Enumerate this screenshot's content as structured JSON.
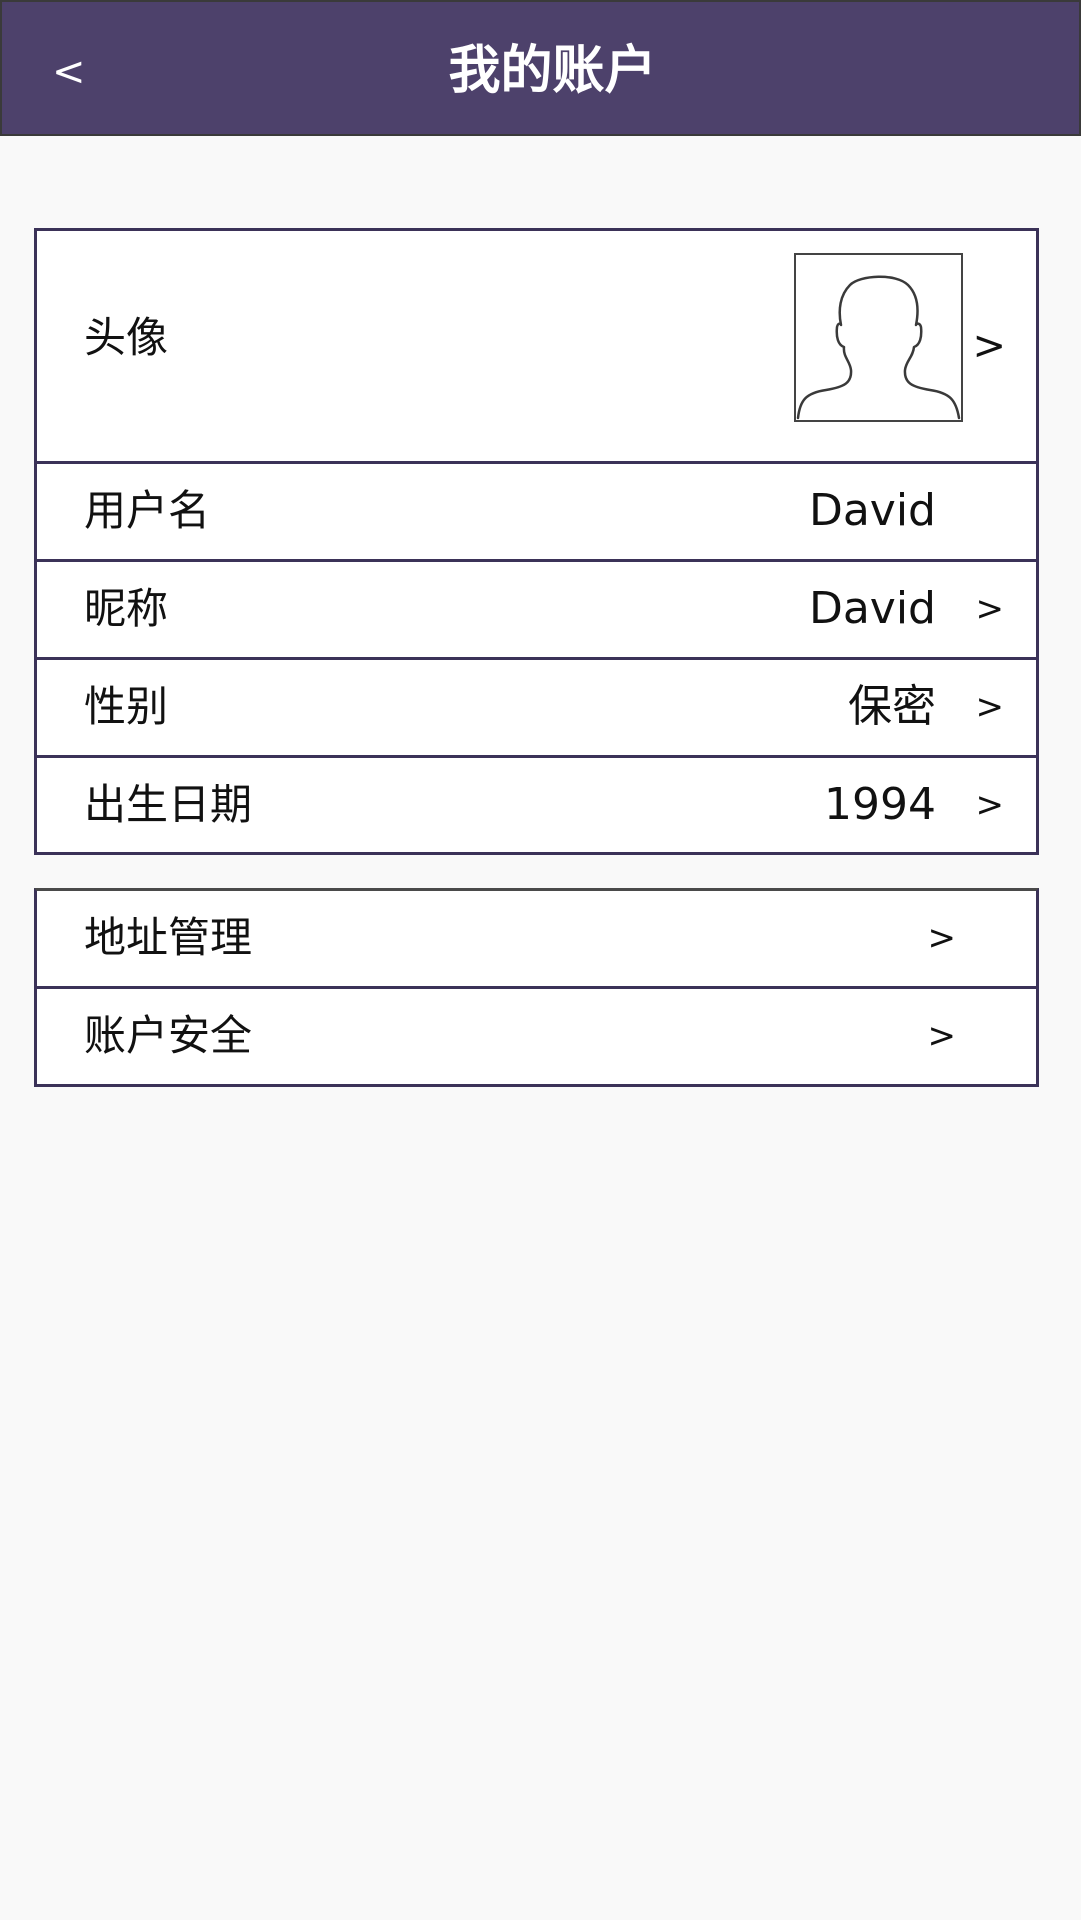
{
  "header": {
    "back_label": "<",
    "title": "我的账户",
    "background": "#4d416b"
  },
  "profile": {
    "avatar": {
      "label": "头像",
      "chevron": ">",
      "icon": "user-silhouette-icon"
    },
    "rows": [
      {
        "label": "用户名",
        "value": "David",
        "chevron": ""
      },
      {
        "label": "昵称",
        "value": "David",
        "chevron": ">"
      },
      {
        "label": "性别",
        "value": "保密",
        "chevron": ">"
      },
      {
        "label": "出生日期",
        "value": "1994",
        "chevron": ">"
      }
    ]
  },
  "settings": {
    "rows": [
      {
        "label": "地址管理",
        "chevron": ">"
      },
      {
        "label": "账户安全",
        "chevron": ">"
      }
    ]
  },
  "colors": {
    "accent": "#4d416b",
    "border": "#3b3258",
    "page_background": "#f9f9f9"
  }
}
